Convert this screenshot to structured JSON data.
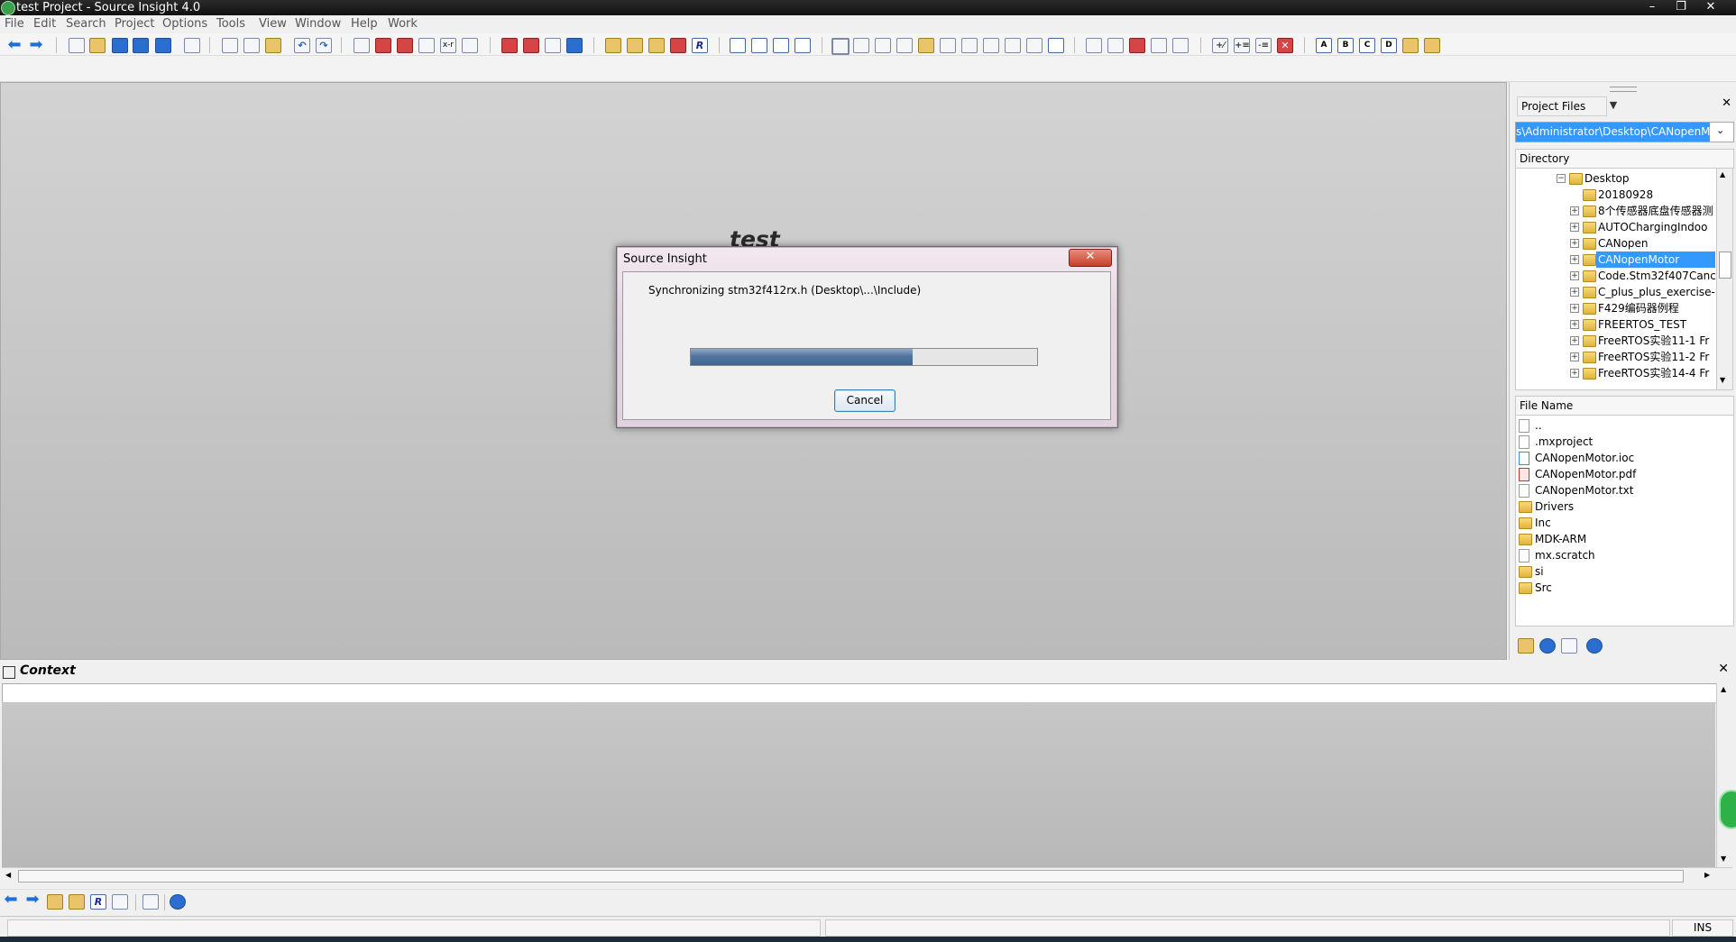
{
  "window": {
    "title": "test Project - Source Insight 4.0"
  },
  "menu": [
    "File",
    "Edit",
    "Search",
    "Project",
    "Options",
    "Tools",
    "View",
    "Window",
    "Help",
    "Work"
  ],
  "editor": {
    "watermark": "test"
  },
  "dialog": {
    "title": "Source Insight",
    "close_label": "✕",
    "message": "Synchronizing stm32f412rx.h (Desktop\\...\\Include)",
    "progress_fraction": 0.64,
    "cancel_label": "Cancel"
  },
  "project_panel": {
    "view_selector": "Project Files",
    "path": "s\\Administrator\\Desktop\\CANopenM",
    "directory_header": "Directory",
    "directory_items": [
      {
        "label": "Desktop",
        "level": 0,
        "expanded": true
      },
      {
        "label": "20180928",
        "level": 1,
        "expanded": false
      },
      {
        "label": "8个传感器底盘传感器测",
        "level": 1,
        "expanded": false
      },
      {
        "label": "AUTOChargingIndoo",
        "level": 1,
        "expanded": false
      },
      {
        "label": "CANopen",
        "level": 1,
        "expanded": false
      },
      {
        "label": "CANopenMotor",
        "level": 1,
        "expanded": false,
        "selected": true
      },
      {
        "label": "Code.Stm32f407Canc",
        "level": 1,
        "expanded": false
      },
      {
        "label": "C_plus_plus_exercise-",
        "level": 1,
        "expanded": false
      },
      {
        "label": "F429编码器例程",
        "level": 1,
        "expanded": false
      },
      {
        "label": "FREERTOS_TEST",
        "level": 1,
        "expanded": false
      },
      {
        "label": "FreeRTOS实验11-1 Fr",
        "level": 1,
        "expanded": false
      },
      {
        "label": "FreeRTOS实验11-2 Fr",
        "level": 1,
        "expanded": false
      },
      {
        "label": "FreeRTOS实验14-4 Fr",
        "level": 1,
        "expanded": false
      }
    ],
    "file_header": "File Name",
    "files": [
      {
        "label": "..",
        "icon": "file-icon"
      },
      {
        "label": ".mxproject",
        "icon": "file-icon"
      },
      {
        "label": "CANopenMotor.ioc",
        "icon": "ioc-file-icon"
      },
      {
        "label": "CANopenMotor.pdf",
        "icon": "pdf-file-icon"
      },
      {
        "label": "CANopenMotor.txt",
        "icon": "file-icon"
      },
      {
        "label": "Drivers",
        "icon": "folder-icon"
      },
      {
        "label": "Inc",
        "icon": "folder-icon"
      },
      {
        "label": "MDK-ARM",
        "icon": "folder-icon"
      },
      {
        "label": "mx.scratch",
        "icon": "file-icon"
      },
      {
        "label": "si",
        "icon": "folder-icon"
      },
      {
        "label": "Src",
        "icon": "folder-icon"
      }
    ]
  },
  "context_panel": {
    "title": "Context",
    "close_label": "✕"
  },
  "status": {
    "insert_mode": "INS"
  },
  "colors": {
    "selection": "#3399ff",
    "progress": "#52769f",
    "titlebar": "#1b1b1b"
  }
}
